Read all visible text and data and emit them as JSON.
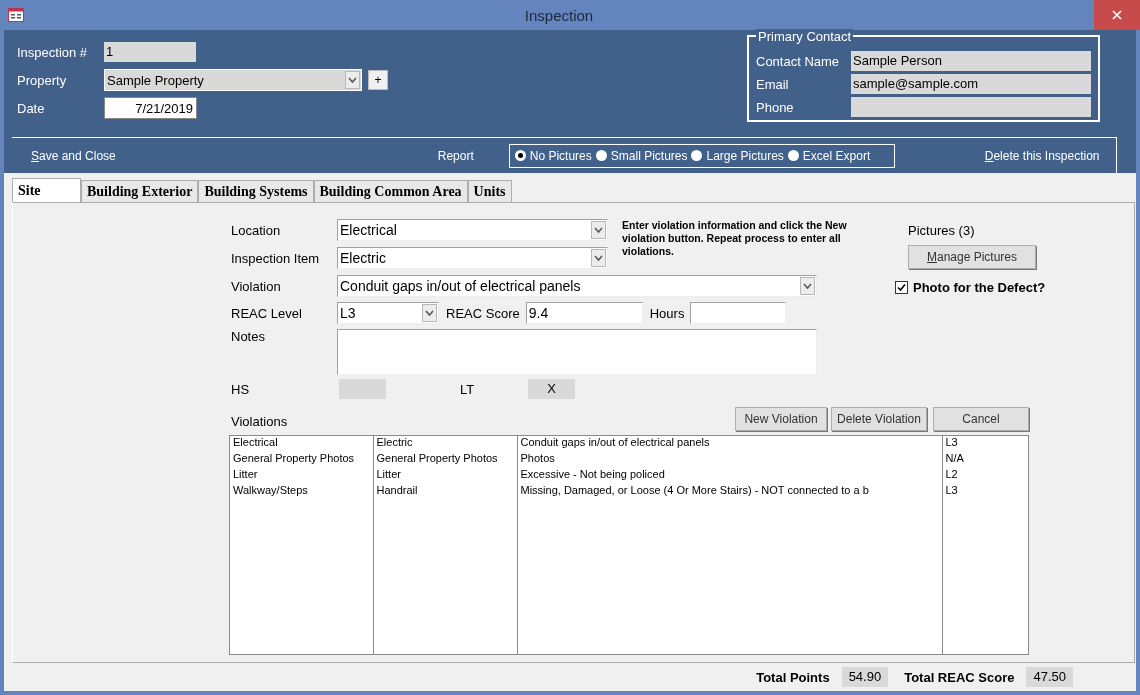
{
  "window": {
    "title": "Inspection"
  },
  "header": {
    "fields": [
      {
        "label": "Inspection #",
        "value": "1",
        "kind": "readonly"
      },
      {
        "label": "Property",
        "value": "Sample Property",
        "kind": "select",
        "add_button": "+"
      },
      {
        "label": "Date",
        "value": "7/21/2019",
        "kind": "date"
      }
    ],
    "primary_contact": {
      "legend": "Primary Contact",
      "fields": [
        {
          "label": "Contact Name",
          "value": "Sample Person"
        },
        {
          "label": "Email",
          "value": "sample@sample.com"
        },
        {
          "label": "Phone"
        }
      ]
    }
  },
  "toolbar": {
    "save_and_close": "Save and Close",
    "report": {
      "label": "Report",
      "options": [
        {
          "label": "No Pictures",
          "selected": true
        },
        {
          "label": "Small Pictures",
          "selected": false
        },
        {
          "label": "Large Pictures",
          "selected": false
        },
        {
          "label": "Excel Export",
          "selected": false
        }
      ]
    },
    "delete": "Delete this Inspection"
  },
  "tabs": [
    {
      "label": "Site",
      "selected": true
    },
    {
      "label": "Building Exterior",
      "selected": false
    },
    {
      "label": "Building Systems",
      "selected": false
    },
    {
      "label": "Building Common Area",
      "selected": false
    },
    {
      "label": "Units",
      "selected": false
    }
  ],
  "form": {
    "location": {
      "label": "Location",
      "value": "Electrical"
    },
    "inspection_item": {
      "label": "Inspection Item",
      "value": "Electric"
    },
    "instructions": "Enter violation information and click the New violation button.  Repeat process to enter all violations.",
    "violation": {
      "label": "Violation",
      "value": "Conduit gaps in/out of electrical panels"
    },
    "reac_level": {
      "label": "REAC Level",
      "value": "L3"
    },
    "reac_score": {
      "label": "REAC Score",
      "value": "9.4"
    },
    "hours": {
      "label": "Hours"
    },
    "notes": {
      "label": "Notes"
    },
    "hs": {
      "label": "HS"
    },
    "lt": {
      "label": "LT",
      "value": "X"
    }
  },
  "pictures": {
    "label": "Pictures (3)",
    "button": "Manage Pictures",
    "photo_checkbox": {
      "label": "Photo for the Defect?",
      "checked": true
    }
  },
  "violations": {
    "label": "Violations",
    "buttons": [
      "New Violation",
      "Delete Violation",
      "Cancel"
    ],
    "rows": [
      [
        "Electrical",
        "Electric",
        "Conduit gaps in/out of electrical panels",
        "L3"
      ],
      [
        "General Property Photos",
        "General Property Photos",
        "Photos",
        "N/A"
      ],
      [
        "Litter",
        "Litter",
        "Excessive - Not being policed",
        "L2"
      ],
      [
        "Walkway/Steps",
        "Handrail",
        "Missing, Damaged, or Loose (4 Or More Stairs) - NOT connected to a b",
        "L3"
      ]
    ]
  },
  "totals": [
    {
      "label": "Total Points",
      "value": "54.90"
    },
    {
      "label": "Total REAC Score",
      "value": "47.50"
    }
  ]
}
